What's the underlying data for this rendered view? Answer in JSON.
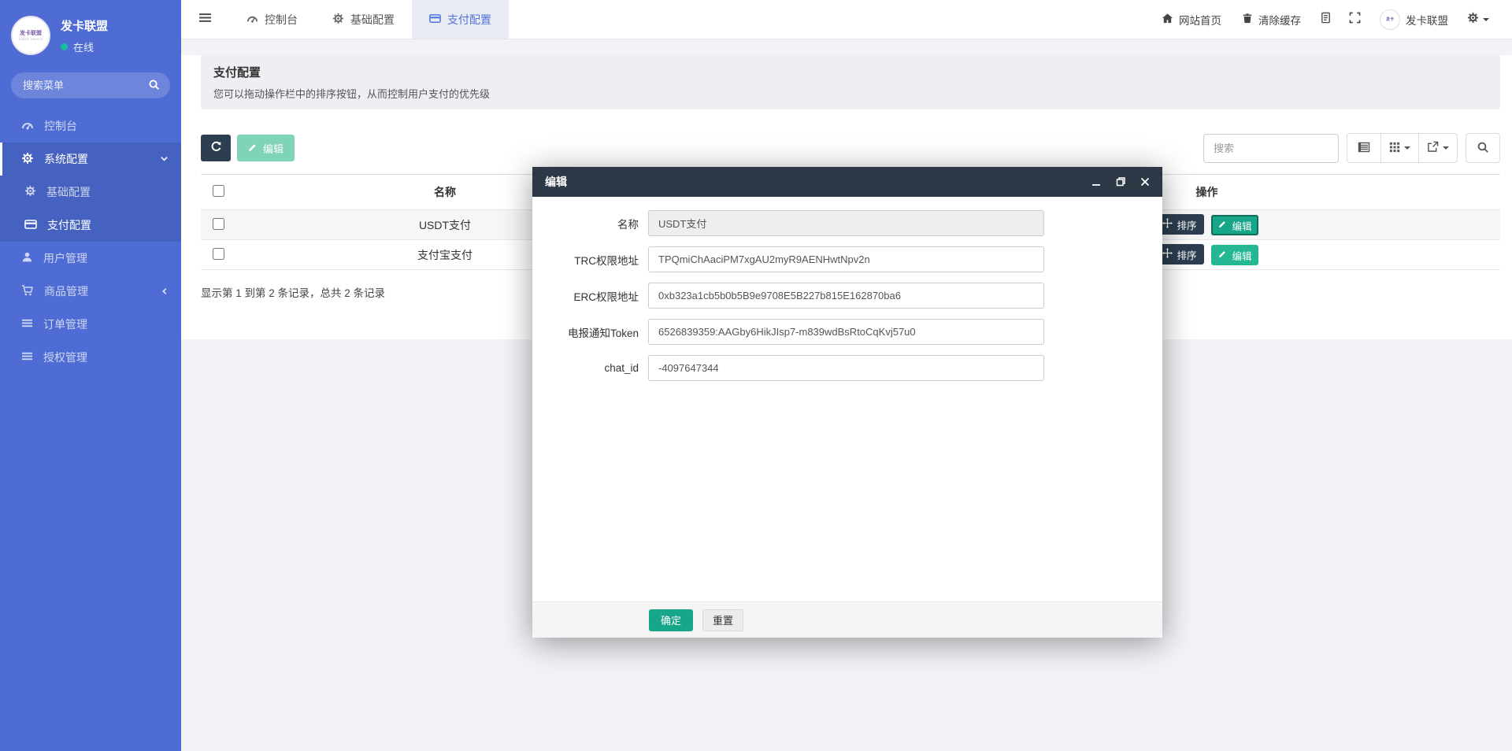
{
  "sidebar": {
    "brand": "发卡联盟",
    "status": "在线",
    "search_placeholder": "搜索菜单",
    "items": [
      {
        "label": "控制台"
      },
      {
        "label": "系统配置"
      },
      {
        "label": "基础配置"
      },
      {
        "label": "支付配置"
      },
      {
        "label": "用户管理"
      },
      {
        "label": "商品管理"
      },
      {
        "label": "订单管理"
      },
      {
        "label": "授权管理"
      }
    ]
  },
  "navbar": {
    "tabs": [
      {
        "label": "控制台"
      },
      {
        "label": "基础配置"
      },
      {
        "label": "支付配置"
      }
    ],
    "home_label": "网站首页",
    "clear_cache_label": "清除缓存",
    "username": "发卡联盟"
  },
  "page_header": {
    "title": "支付配置",
    "description": "您可以拖动操作栏中的排序按钮，从而控制用户支付的优先级"
  },
  "toolbar": {
    "edit_label": "编辑",
    "search_placeholder": "搜索"
  },
  "table": {
    "columns": {
      "name": "名称",
      "actions": "操作"
    },
    "rows": [
      {
        "name": "USDT支付"
      },
      {
        "name": "支付宝支付"
      }
    ],
    "sort_label": "排序",
    "edit_label": "编辑",
    "summary": "显示第 1 到第 2 条记录，总共 2 条记录"
  },
  "modal": {
    "title": "编辑",
    "fields": [
      {
        "label": "名称",
        "value": "USDT支付"
      },
      {
        "label": "TRC权限地址",
        "value": "TPQmiChAaciPM7xgAU2myR9AENHwtNpv2n"
      },
      {
        "label": "ERC权限地址",
        "value": "0xb323a1cb5b0b5B9e9708E5B227b815E162870ba6"
      },
      {
        "label": "电报通知Token",
        "value": "6526839359:AAGby6HikJIsp7-m839wdBsRtoCqKvj57u0"
      },
      {
        "label": "chat_id",
        "value": "-4097647344"
      }
    ],
    "ok_label": "确定",
    "reset_label": "重置"
  },
  "colors": {
    "sidebar_blue": "#4e6cd3",
    "accent_blue": "#4e73df",
    "success_green": "#18a689",
    "dark_navy": "#2c3e50",
    "online_green": "#1abc9c",
    "modal_header": "#2d3847"
  }
}
